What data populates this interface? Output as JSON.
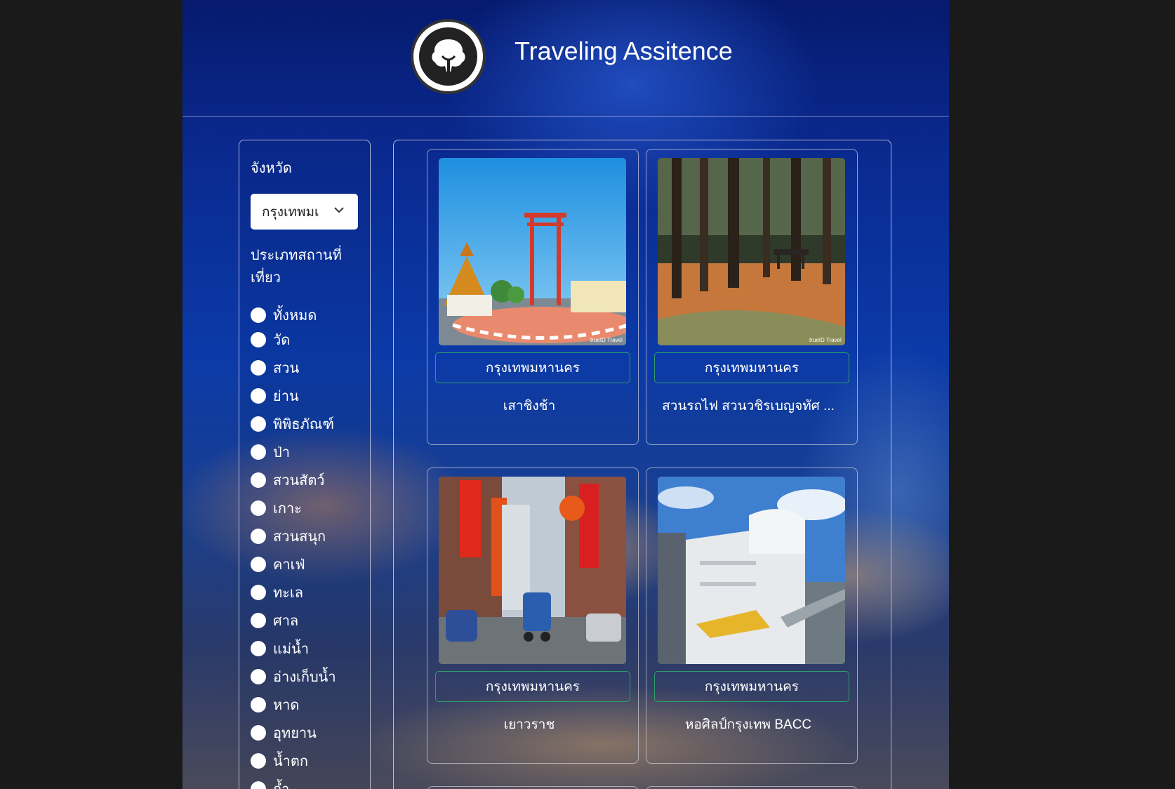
{
  "header": {
    "title": "Traveling Assitence",
    "logo_icon": "tree-logo-icon"
  },
  "sidebar": {
    "province_label": "จังหวัด",
    "province_selected": "กรุงเทพมเ",
    "type_label_line1": "ประเภทสถานที่",
    "type_label_line2": "เที่ยว",
    "types": [
      "ทั้งหมด",
      "วัด",
      "สวน",
      "ย่าน",
      "พิพิธภัณฑ์",
      "ป่า",
      "สวนสัตว์",
      "เกาะ",
      "สวนสนุก",
      "คาเฟ่",
      "ทะเล",
      "ศาล",
      "แม่น้ำ",
      "อ่างเก็บน้ำ",
      "หาด",
      "อุทยาน",
      "น้ำตก",
      "ถ้ำ"
    ]
  },
  "cards": [
    {
      "province": "กรุงเทพมหานคร",
      "name": "เสาชิงช้า",
      "watermark": "trueID Travel"
    },
    {
      "province": "กรุงเทพมหานคร",
      "name": "สวนรถไฟ สวนวชิรเบญจทัศ ...",
      "watermark": "trueID Travel"
    },
    {
      "province": "กรุงเทพมหานคร",
      "name": "เยาวราช"
    },
    {
      "province": "กรุงเทพมหานคร",
      "name": "หอศิลป์กรุงเทพ BACC"
    }
  ],
  "colors": {
    "accent_border": "#2e9e6a",
    "bg_top": "#061a6e"
  }
}
